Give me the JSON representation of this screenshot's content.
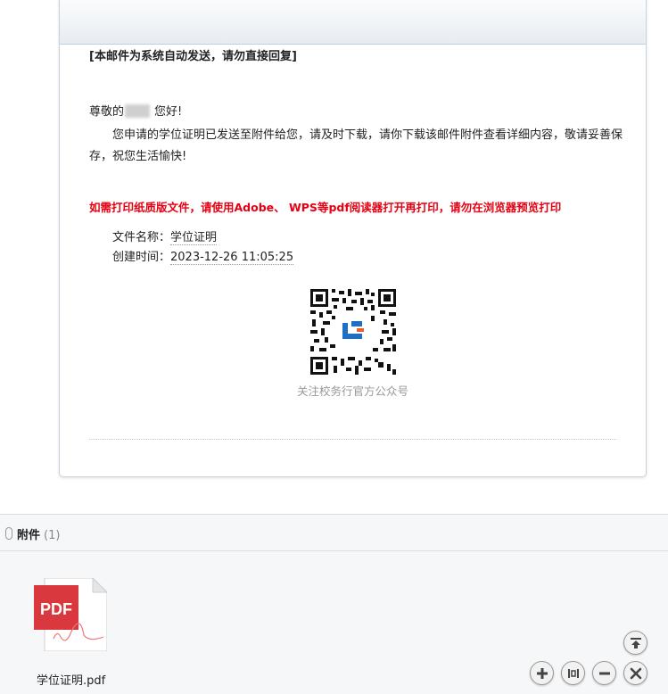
{
  "mail": {
    "auto_notice": "[本邮件为系统自动发送，请勿直接回复]",
    "greeting_prefix": "尊敬的",
    "greeting_suffix": "您好!",
    "body": "您申请的学位证明已发送至附件给您，请及时下载，请你下载该邮件附件查看详细内容，敬请妥善保存，祝您生活愉快!",
    "red_note": "如需打印纸质版文件，请使用Adobe、 WPS等pdf阅读器打开再打印，请勿在浏览器预览打印",
    "file_name_label": "文件名称：",
    "file_name_value": "学位证明",
    "created_label": "创建时间：",
    "created_value": "2023-12-26 11:05:25",
    "qr_caption": "关注校务行官方公众号"
  },
  "attachments": {
    "title": "附件",
    "count": "(1)",
    "items": [
      {
        "icon_text": "PDF",
        "name": "学位证明.pdf"
      }
    ]
  },
  "colors": {
    "red_note": "#e60012",
    "pdf_red": "#d9393e",
    "qr_blue": "#1f6fc4",
    "qr_orange": "#e8602c"
  },
  "icons": {
    "scroll_top": "scroll-top-icon",
    "zoom_in": "plus-icon",
    "fit": "fit-width-icon",
    "zoom_out": "minus-icon",
    "close": "close-icon"
  }
}
